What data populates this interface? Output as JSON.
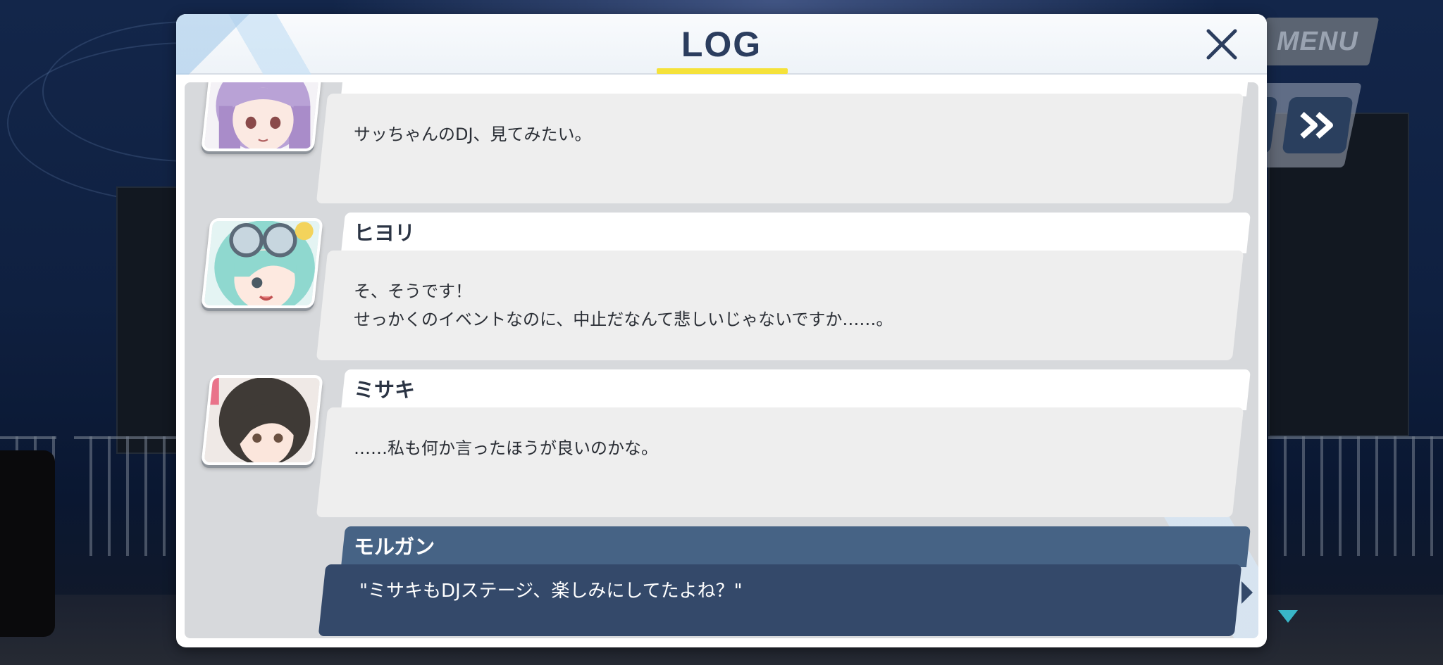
{
  "hud": {
    "menu_label": "MENU",
    "fast_forward_icon": "double-chevron-right-icon"
  },
  "log": {
    "title": "LOG",
    "close_icon": "close-icon",
    "accent_color": "#f5e23a",
    "entries": [
      {
        "speaker": "",
        "text": "サッちゃんのDJ、見てみたい。",
        "avatar": "purple-hair-girl-portrait"
      },
      {
        "speaker": "ヒヨリ",
        "text": "そ、そうです！\nせっかくのイベントなのに、中止だなんて悲しいじゃないですか……。",
        "avatar": "mint-hair-girl-with-goggles-portrait"
      },
      {
        "speaker": "ミサキ",
        "text": "……私も何か言ったほうが良いのかな。",
        "avatar": "dark-hair-girl-portrait"
      },
      {
        "speaker": "モルガン",
        "text": "\"ミサキもDJステージ、楽しみにしてたよね？\"",
        "avatar": ""
      }
    ]
  },
  "scroll_indicator_icon": "triangle-down-icon"
}
